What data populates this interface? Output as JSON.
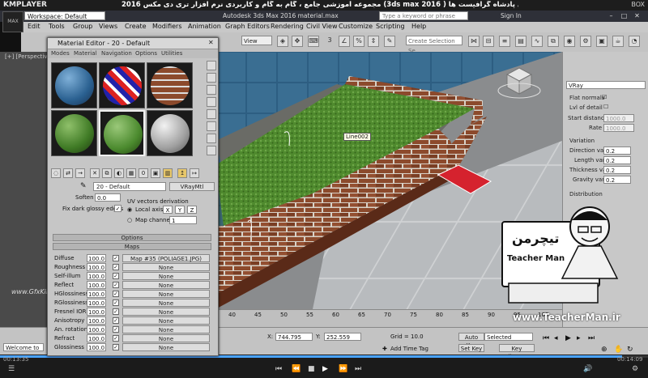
{
  "player": {
    "logo": "KMPLAYER",
    "title": "مجموعه آموزشی جامع ، گام به گام و کاربردی نرم افزار تری دی مکس 2016 (3ds max 2016 ) مدرس : سعید فدایی (تیچرمن) گروه آموزشی پادشاه گرافیست ها",
    "right": "BOX",
    "time_elapsed": "00:13:35",
    "time_total": "00:14:09",
    "progress": 0.96
  },
  "app": {
    "logo_label": "MAX",
    "workspace_label": "Workspace: Default",
    "title": "Autodesk 3ds Max 2016    material.max",
    "search_placeholder": "Type a keyword or phrase",
    "signin": "Sign In",
    "help": "?"
  },
  "menu": [
    "Edit",
    "Tools",
    "Group",
    "Views",
    "Create",
    "Modifiers",
    "Animation",
    "Graph Editors",
    "Rendering",
    "Civil View",
    "Customize",
    "Scripting",
    "Help"
  ],
  "toolbar": {
    "view_dropdown": "View",
    "selection_set": "Create Selection Se",
    "snap_label": "3"
  },
  "viewport": {
    "label": "[+] [Perspective]",
    "tooltip": "Line002"
  },
  "material_editor": {
    "title": "Material Editor - 20 - Default",
    "menus": [
      "Modes",
      "Material",
      "Navigation",
      "Options",
      "Utilities"
    ],
    "material_name": "20 - Default",
    "material_type": "VRayMtl",
    "soften_label": "Soften",
    "soften_value": "0.0",
    "uv_group": "UV vectors derivation",
    "fix_dark_label": "Fix dark glossy edges",
    "fix_dark_checked": "✓",
    "local_axis_label": "Local axis",
    "axes": [
      "X",
      "Y",
      "Z"
    ],
    "map_channel_label": "Map channel",
    "map_channel_value": "1",
    "options_rollout": "Options",
    "maps_rollout": "Maps",
    "maps": [
      {
        "name": "Diffuse",
        "amount": "100.0",
        "checked": "✓",
        "map": "Map #35 (POLIAGE1.JPG)"
      },
      {
        "name": "Roughness",
        "amount": "100.0",
        "checked": "✓",
        "map": "None"
      },
      {
        "name": "Self-illum",
        "amount": "100.0",
        "checked": "✓",
        "map": "None"
      },
      {
        "name": "Reflect",
        "amount": "100.0",
        "checked": "✓",
        "map": "None"
      },
      {
        "name": "HGlossiness",
        "amount": "100.0",
        "checked": "✓",
        "map": "None"
      },
      {
        "name": "RGlossiness",
        "amount": "100.0",
        "checked": "✓",
        "map": "None"
      },
      {
        "name": "Fresnel IOR",
        "amount": "100.0",
        "checked": "✓",
        "map": "None"
      },
      {
        "name": "Anisotropy",
        "amount": "100.0",
        "checked": "✓",
        "map": "None"
      },
      {
        "name": "An. rotation",
        "amount": "100.0",
        "checked": "✓",
        "map": "None"
      },
      {
        "name": "Refract",
        "amount": "100.0",
        "checked": "✓",
        "map": "None"
      },
      {
        "name": "Glossiness",
        "amount": "100.0",
        "checked": "✓",
        "map": "None"
      }
    ]
  },
  "command_panel": {
    "renderer_dropdown": "VRay",
    "flat_normals_label": "Flat normals",
    "lvl_detail_label": "Lvl of detail",
    "start_distance_label": "Start distance",
    "start_distance_value": "1000.0",
    "rate_label": "Rate",
    "rate_value": "1000.0",
    "variation_group": "Variation",
    "direction_var_label": "Direction var",
    "direction_var_value": "0.2",
    "length_var_label": "Length var",
    "length_var_value": "0.2",
    "thickness_var_label": "Thickness var",
    "thickness_var_value": "0.2",
    "gravity_var_label": "Gravity var",
    "gravity_var_value": "0.2",
    "distribution_group": "Distribution"
  },
  "timeline": {
    "ticks": [
      "40",
      "45",
      "50",
      "55",
      "60",
      "65",
      "70",
      "75",
      "80",
      "85",
      "90",
      "95",
      "100"
    ]
  },
  "status": {
    "x_label": "X:",
    "x_value": "744.795",
    "y_label": "Y:",
    "y_value": "252.559",
    "grid": "Grid = 10.0",
    "add_time_tag": "Add Time Tag",
    "auto_key": "Auto Key",
    "selected": "Selected",
    "set_key": "Set Key",
    "key_filters": "Key Filters...",
    "welcome": "Welcome to"
  },
  "watermark": {
    "url": "www.TeacherMan.ir",
    "brand": "Teacher Man",
    "site": "www.GfxKing.ir"
  },
  "colors": {
    "active_slot": "#f0f0f0",
    "red_box": "#d5222e",
    "grass": "#4f8a2e",
    "player_progress": "#4aa3ff"
  }
}
